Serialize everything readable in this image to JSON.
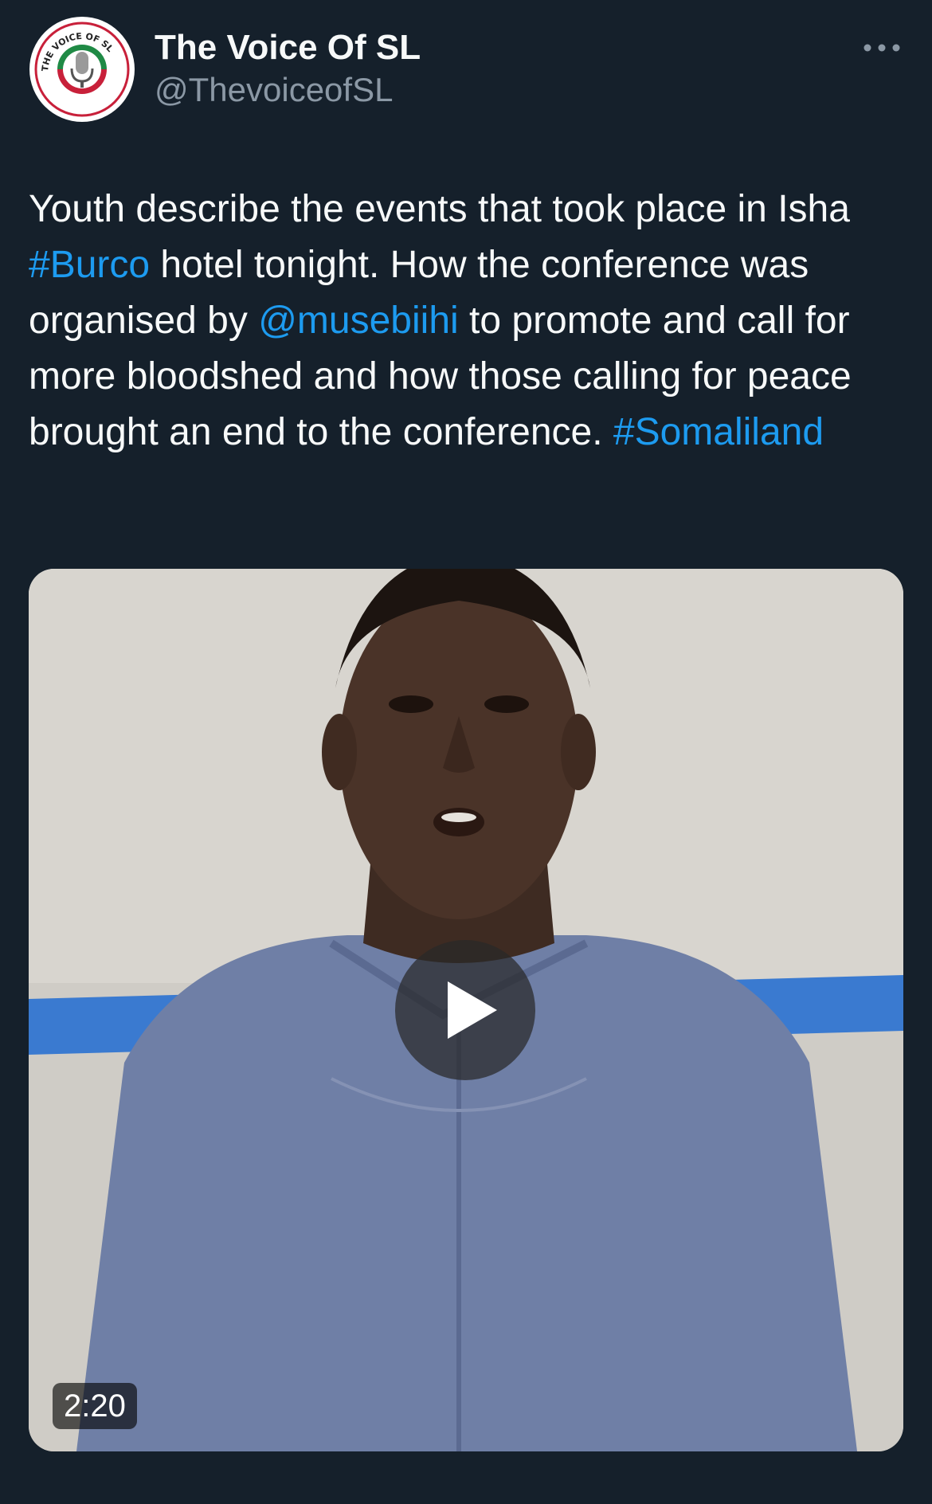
{
  "author": {
    "display_name": "The Voice Of SL",
    "handle": "@ThevoiceofSL",
    "avatar_icon": "microphone-logo-icon",
    "avatar_logo_text": "THE VOICE OF SL"
  },
  "more_icon": "more-options-icon",
  "tweet": {
    "segments": [
      {
        "text": "Youth describe the events that took place in Isha ",
        "type": "text"
      },
      {
        "text": "#Burco",
        "type": "hashtag"
      },
      {
        "text": " hotel tonight. How the conference was organised by ",
        "type": "text"
      },
      {
        "text": "@musebiihi",
        "type": "mention"
      },
      {
        "text": " to promote and call for more bloodshed and how those calling for peace brought an end to the conference. ",
        "type": "text"
      },
      {
        "text": "#Somaliland",
        "type": "hashtag"
      }
    ]
  },
  "media": {
    "type": "video",
    "duration": "2:20",
    "play_icon": "play-icon"
  },
  "colors": {
    "background": "#15202b",
    "text_primary": "#f7f9f9",
    "text_secondary": "#8b98a5",
    "link": "#1d9bf0"
  }
}
